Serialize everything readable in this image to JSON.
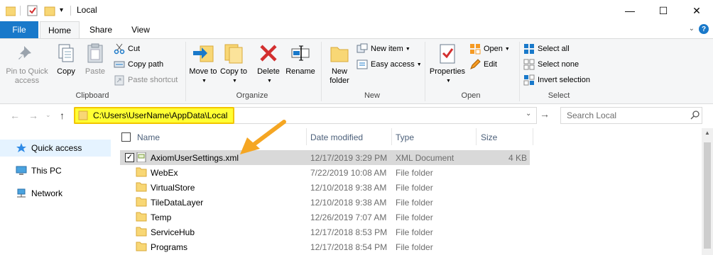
{
  "window": {
    "title": "Local",
    "minimize": "—",
    "maximize": "☐",
    "close": "✕",
    "qa_dropdown": "▾"
  },
  "tabs": {
    "file": "File",
    "home": "Home",
    "share": "Share",
    "view": "View",
    "expand": "⌄",
    "help": "?"
  },
  "ribbon": {
    "clipboard": {
      "pin": "Pin to Quick access",
      "copy": "Copy",
      "paste": "Paste",
      "cut": "Cut",
      "copy_path": "Copy path",
      "paste_shortcut": "Paste shortcut",
      "label": "Clipboard"
    },
    "organize": {
      "move_to": "Move to",
      "copy_to": "Copy to",
      "delete": "Delete",
      "rename": "Rename",
      "label": "Organize"
    },
    "new": {
      "new_folder": "New folder",
      "new_item": "New item",
      "easy_access": "Easy access",
      "label": "New"
    },
    "open": {
      "properties": "Properties",
      "open": "Open",
      "edit": "Edit",
      "label": "Open"
    },
    "select": {
      "select_all": "Select all",
      "select_none": "Select none",
      "invert": "Invert selection",
      "label": "Select"
    }
  },
  "address": {
    "path": "C:\\Users\\UserName\\AppData\\Local",
    "search_placeholder": "Search Local"
  },
  "nav": [
    {
      "label": "Quick access",
      "icon": "star-icon"
    },
    {
      "label": "This PC",
      "icon": "computer-icon"
    },
    {
      "label": "Network",
      "icon": "network-icon"
    }
  ],
  "columns": {
    "name": "Name",
    "date": "Date modified",
    "type": "Type",
    "size": "Size"
  },
  "files": [
    {
      "name": "AxiomUserSettings.xml",
      "date": "12/17/2019 3:29 PM",
      "type": "XML Document",
      "size": "4 KB",
      "kind": "xml",
      "selected": true
    },
    {
      "name": "WebEx",
      "date": "7/22/2019 10:08 AM",
      "type": "File folder",
      "size": "",
      "kind": "folder"
    },
    {
      "name": "VirtualStore",
      "date": "12/10/2018 9:38 AM",
      "type": "File folder",
      "size": "",
      "kind": "folder"
    },
    {
      "name": "TileDataLayer",
      "date": "12/10/2018 9:38 AM",
      "type": "File folder",
      "size": "",
      "kind": "folder"
    },
    {
      "name": "Temp",
      "date": "12/26/2019 7:07 AM",
      "type": "File folder",
      "size": "",
      "kind": "folder"
    },
    {
      "name": "ServiceHub",
      "date": "12/17/2018 8:53 PM",
      "type": "File folder",
      "size": "",
      "kind": "folder"
    },
    {
      "name": "Programs",
      "date": "12/17/2018 8:54 PM",
      "type": "File folder",
      "size": "",
      "kind": "folder"
    }
  ],
  "colors": {
    "file_tab": "#1979ca",
    "address_highlight": "#ffff33",
    "callout_arrow": "#f5a623",
    "selected_row": "#d9d9d9"
  }
}
